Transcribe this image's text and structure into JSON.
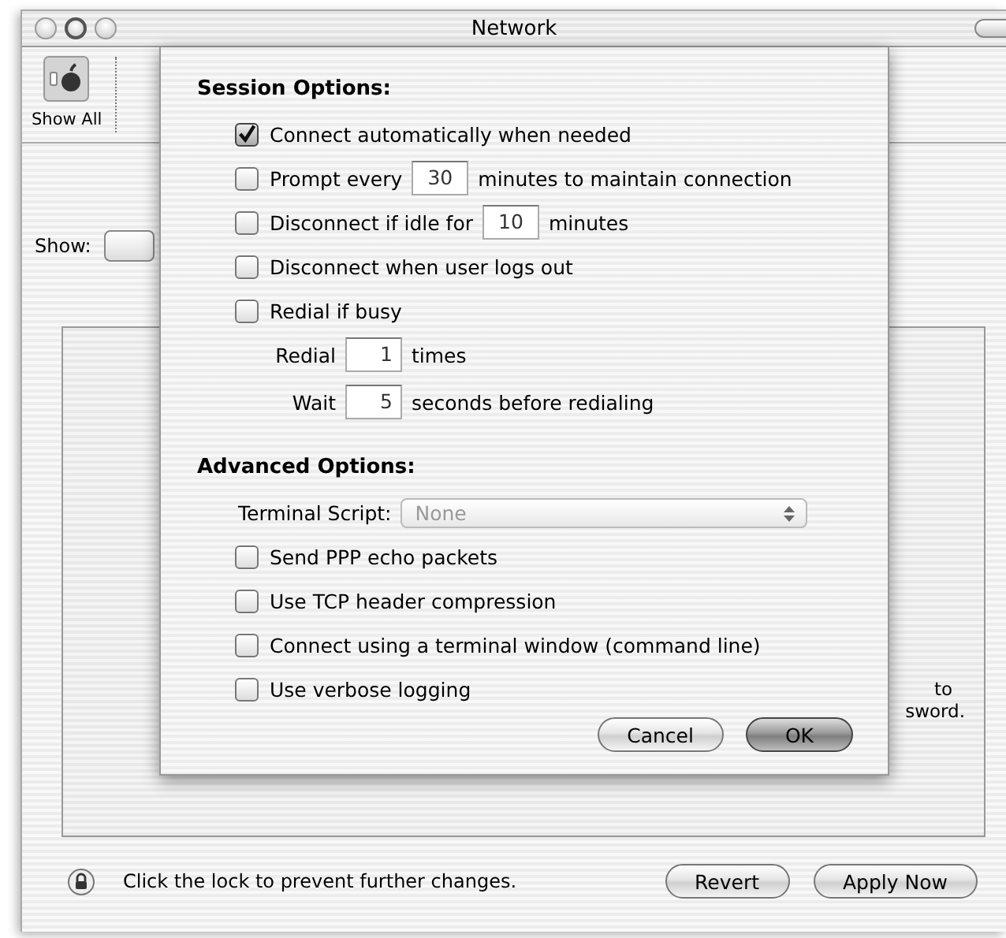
{
  "window": {
    "title": "Network"
  },
  "toolbar": {
    "items": [
      {
        "label": "Show All"
      }
    ]
  },
  "show": {
    "label": "Show:"
  },
  "panel": {
    "note_fragments": [
      "to",
      "sword."
    ]
  },
  "sheet": {
    "session": {
      "heading": "Session Options:",
      "items": [
        {
          "kind": "checkbox",
          "label": "Connect automatically when needed",
          "checked": true
        },
        {
          "kind": "checkbox_field",
          "before": "Prompt every",
          "value": "30",
          "after": "minutes to maintain connection",
          "checked": false
        },
        {
          "kind": "checkbox_field",
          "before": "Disconnect if idle for",
          "value": "10",
          "after": "minutes",
          "checked": false
        },
        {
          "kind": "checkbox",
          "label": "Disconnect when user logs out",
          "checked": false
        },
        {
          "kind": "checkbox",
          "label": "Redial if busy",
          "checked": false
        },
        {
          "kind": "field",
          "before": "Redial",
          "value": "1",
          "after": "times"
        },
        {
          "kind": "field",
          "before": "Wait",
          "value": "5",
          "after": "seconds before redialing"
        }
      ]
    },
    "advanced": {
      "heading": "Advanced Options:",
      "terminal_script": {
        "label": "Terminal Script:",
        "value": "None",
        "disabled": true
      },
      "items": [
        {
          "kind": "checkbox",
          "label": "Send PPP echo packets",
          "checked": false
        },
        {
          "kind": "checkbox",
          "label": "Use TCP header compression",
          "checked": false
        },
        {
          "kind": "checkbox",
          "label": "Connect using a terminal window (command line)",
          "checked": false
        },
        {
          "kind": "checkbox",
          "label": "Use verbose logging",
          "checked": false
        }
      ]
    },
    "buttons": [
      {
        "label": "Cancel",
        "default": false
      },
      {
        "label": "OK",
        "default": true
      }
    ]
  },
  "status": {
    "lock_message": "Click the lock to prevent further changes."
  },
  "buttons": [
    {
      "label": "Revert"
    },
    {
      "label": "Apply Now"
    }
  ]
}
